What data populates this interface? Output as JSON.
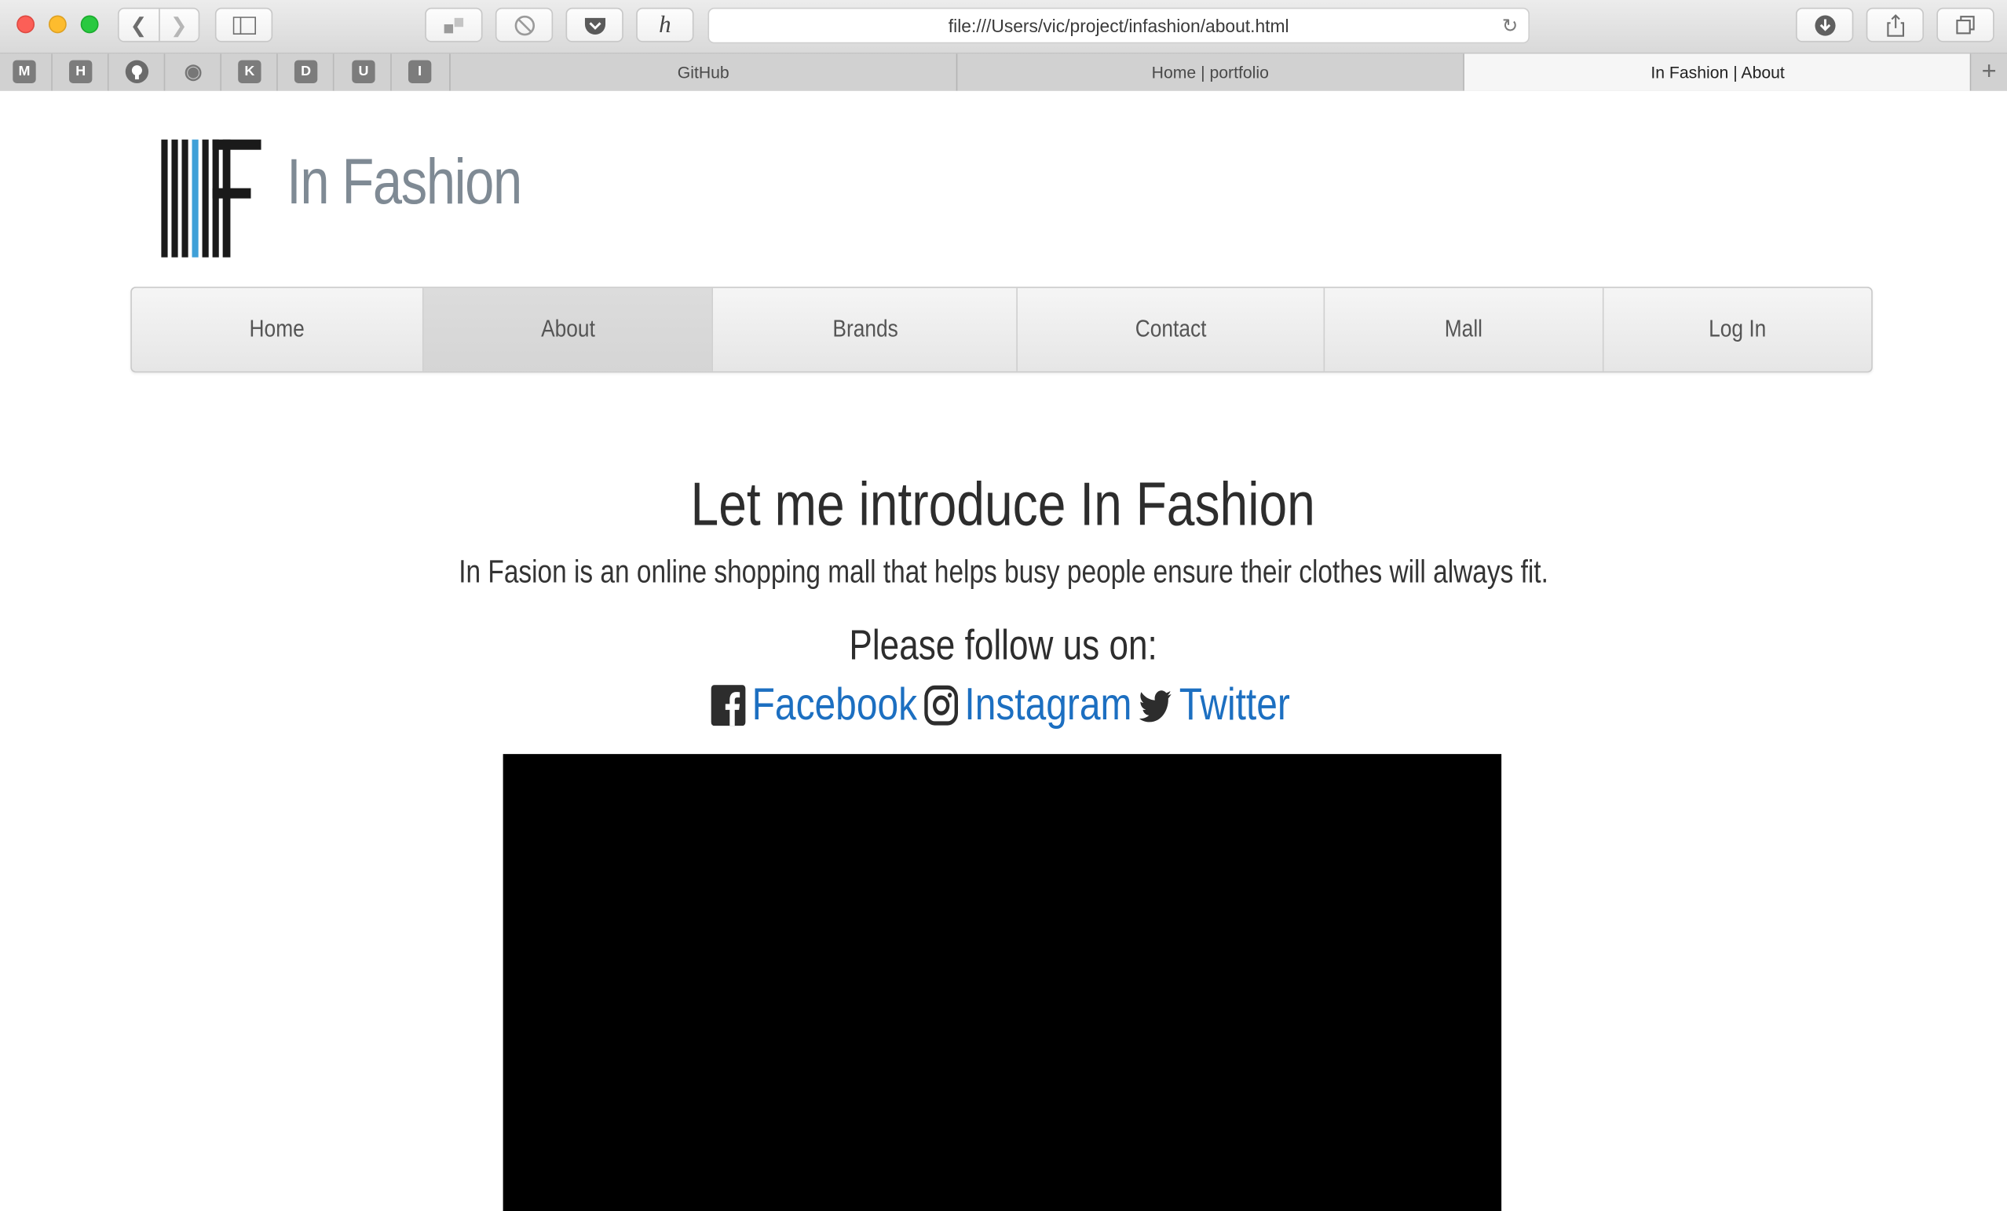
{
  "browser": {
    "url": "file:///Users/vic/project/infashion/about.html",
    "favorites": [
      "M",
      "H",
      "I",
      "K",
      "D",
      "U",
      "I"
    ],
    "tabs": [
      {
        "label": "GitHub",
        "active": false
      },
      {
        "label": "Home | portfolio",
        "active": false
      },
      {
        "label": "In Fashion | About",
        "active": true
      }
    ]
  },
  "site": {
    "title": "In Fashion",
    "brand_color": "#7f8a94",
    "accent_color": "#3fa0d8"
  },
  "nav": {
    "items": [
      {
        "label": "Home",
        "active": false
      },
      {
        "label": "About",
        "active": true
      },
      {
        "label": "Brands",
        "active": false
      },
      {
        "label": "Contact",
        "active": false
      },
      {
        "label": "Mall",
        "active": false
      },
      {
        "label": "Log In",
        "active": false
      }
    ]
  },
  "main": {
    "headline": "Let me introduce In Fashion",
    "description": "In Fasion is an online shopping mall that helps busy people ensure their clothes will always fit.",
    "follow_prompt": "Please follow us on:",
    "social": [
      {
        "label": "Facebook",
        "icon": "facebook-icon"
      },
      {
        "label": "Instagram",
        "icon": "instagram-icon"
      },
      {
        "label": "Twitter",
        "icon": "twitter-icon"
      }
    ],
    "link_color": "#1c6fc1"
  }
}
